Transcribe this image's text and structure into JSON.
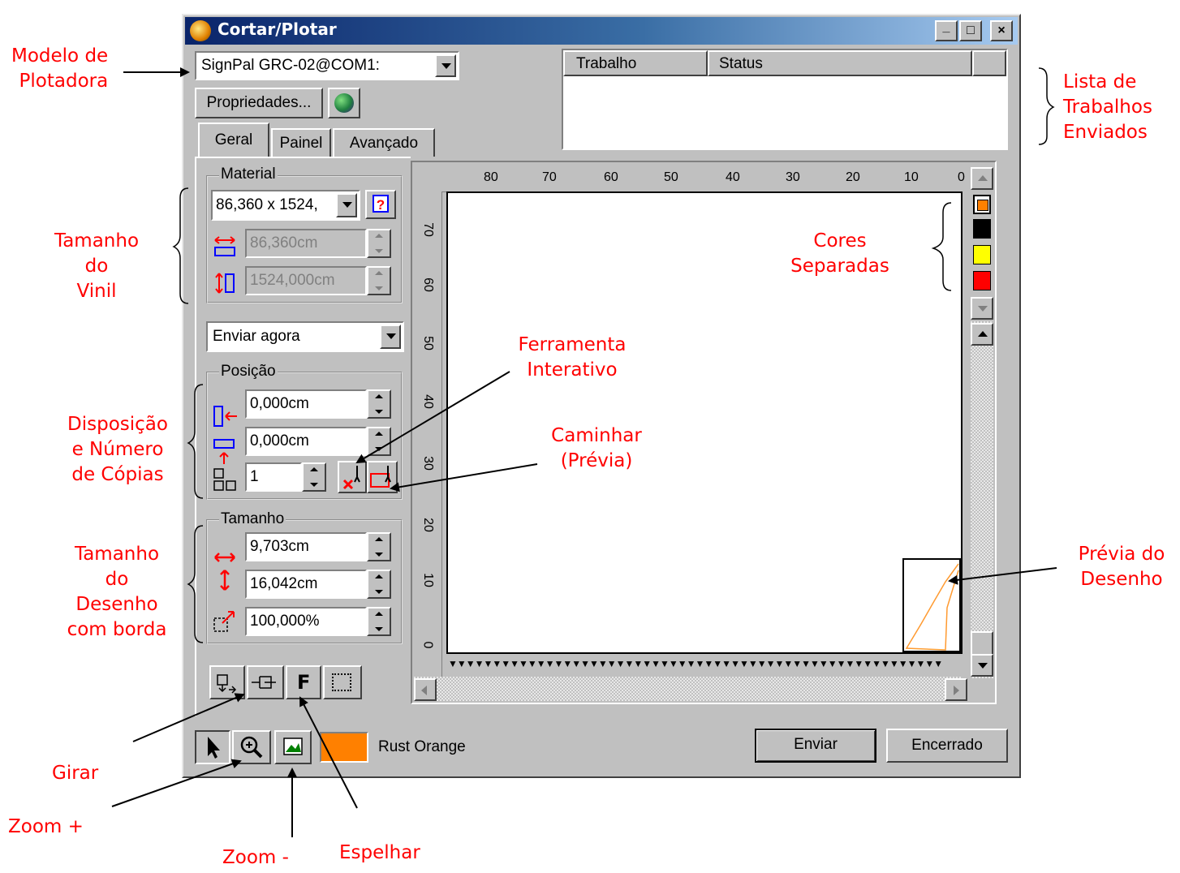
{
  "window": {
    "title": "Cortar/Plotar",
    "controls": [
      "_",
      "□",
      "×"
    ]
  },
  "plotter": {
    "selected": "SignPal GRC-02@COM1:",
    "properties_label": "Propriedades..."
  },
  "job_list": {
    "columns": [
      "Trabalho",
      "Status"
    ]
  },
  "tabs": [
    {
      "label": "Geral",
      "active": true
    },
    {
      "label": "Painel",
      "active": false
    },
    {
      "label": "Avançado",
      "active": false
    }
  ],
  "material": {
    "group_label": "Material",
    "size_selected": "86,360 x 1524,",
    "width": "86,360cm",
    "height": "1524,000cm"
  },
  "send_mode": {
    "selected": "Enviar agora"
  },
  "position": {
    "group_label": "Posição",
    "x": "0,000cm",
    "y": "0,000cm",
    "copies": "1"
  },
  "size": {
    "group_label": "Tamanho",
    "width": "9,703cm",
    "height": "16,042cm",
    "scale": "100,000%"
  },
  "ruler": {
    "h_ticks": [
      "80",
      "70",
      "60",
      "50",
      "40",
      "30",
      "20",
      "10",
      "0"
    ],
    "v_ticks": [
      "70",
      "60",
      "50",
      "40",
      "30",
      "20",
      "10",
      "0"
    ]
  },
  "colors": {
    "swatches": [
      "#ff8000",
      "#000000",
      "#ffff00",
      "#ff0000"
    ],
    "current_color": "#ff8000",
    "current_name": "Rust Orange"
  },
  "buttons": {
    "send": "Enviar",
    "close": "Encerrado"
  },
  "annotations": {
    "modelo": "Modelo de\nPlotadora",
    "lista": "Lista de\nTrabalhos\nEnviados",
    "tamanho_vinil": "Tamanho\ndo\nVinil",
    "cores": "Cores\nSeparadas",
    "ferramenta": "Ferramenta\nInterativo",
    "caminhar": "Caminhar\n(Prévia)",
    "disposicao": "Disposição\ne Número\nde Cópias",
    "tamanho_desenho": "Tamanho\ndo\nDesenho\ncom borda",
    "previa": "Prévia do\nDesenho",
    "girar": "Girar",
    "zoom_plus": "Zoom +",
    "zoom_minus": "Zoom -",
    "espelhar": "Espelhar"
  }
}
